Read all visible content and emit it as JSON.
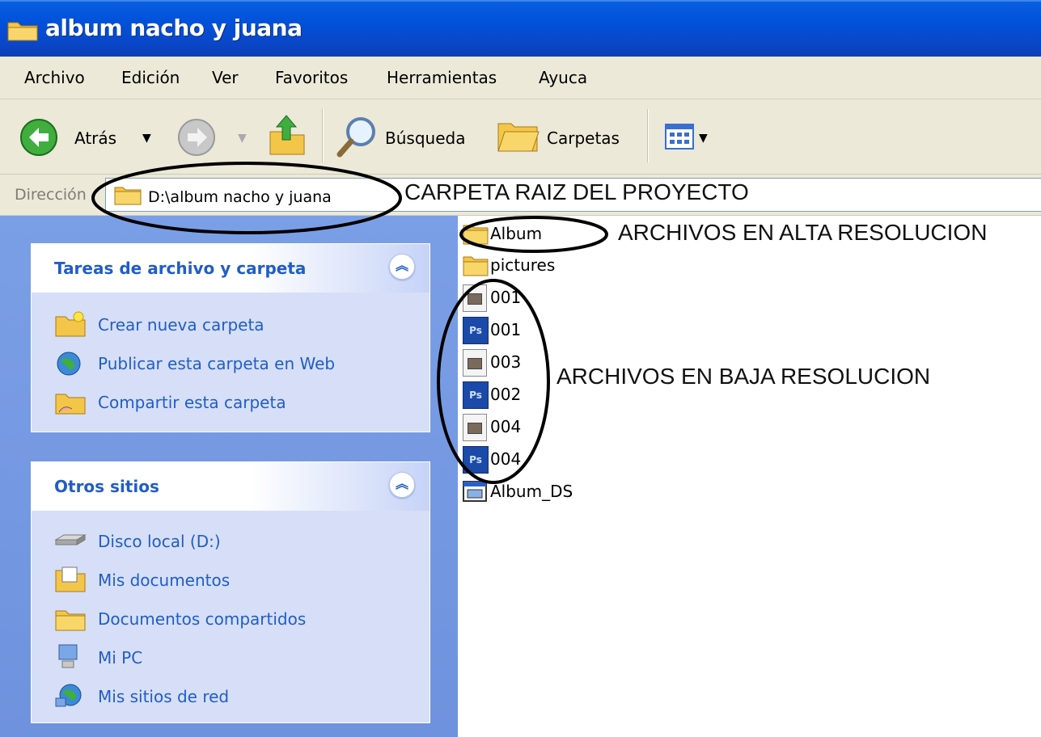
{
  "window": {
    "title": "album nacho y juana"
  },
  "menu": [
    "Archivo",
    "Edición",
    "Ver",
    "Favoritos",
    "Herramientas",
    "Ayuca"
  ],
  "toolbar": {
    "back_label": "Atrás",
    "search_label": "Búsqueda",
    "folders_label": "Carpetas"
  },
  "address": {
    "label": "Dirección",
    "value": "D:\\album nacho y juana"
  },
  "left_panel": {
    "tasks": {
      "title": "Tareas de archivo y carpeta",
      "items": [
        {
          "label": "Crear nueva carpeta",
          "icon": "new-folder-icon"
        },
        {
          "label": "Publicar esta carpeta en Web",
          "icon": "publish-web-icon"
        },
        {
          "label": "Compartir esta carpeta",
          "icon": "share-folder-icon"
        }
      ]
    },
    "other_places": {
      "title": "Otros sitios",
      "items": [
        {
          "label": "Disco local (D:)",
          "icon": "local-disk-icon"
        },
        {
          "label": "Mis documentos",
          "icon": "my-documents-icon"
        },
        {
          "label": "Documentos compartidos",
          "icon": "shared-documents-icon"
        },
        {
          "label": "Mi PC",
          "icon": "my-computer-icon"
        },
        {
          "label": "Mis sitios de red",
          "icon": "network-places-icon"
        }
      ]
    }
  },
  "files": [
    {
      "name": "Album",
      "type": "folder"
    },
    {
      "name": "pictures",
      "type": "folder"
    },
    {
      "name": "001",
      "type": "image"
    },
    {
      "name": "001",
      "type": "psd"
    },
    {
      "name": "003",
      "type": "image"
    },
    {
      "name": "002",
      "type": "psd"
    },
    {
      "name": "004",
      "type": "image"
    },
    {
      "name": "004",
      "type": "psd"
    },
    {
      "name": "Album_DS",
      "type": "app"
    }
  ],
  "annotations": {
    "root": "CARPETA RAIZ DEL PROYECTO",
    "high_res": "ARCHIVOS EN ALTA RESOLUCION",
    "low_res": "ARCHIVOS EN BAJA RESOLUCION"
  },
  "colors": {
    "titlebar": "#0052da",
    "panel": "#7b9fe6",
    "link": "#215dc6",
    "chrome": "#ece9d8"
  }
}
